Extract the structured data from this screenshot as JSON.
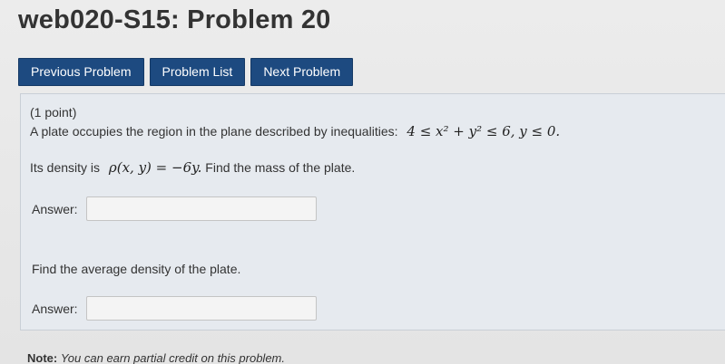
{
  "header": {
    "title": "web020-S15: Problem 20"
  },
  "nav": {
    "previous_label": "Previous Problem",
    "list_label": "Problem List",
    "next_label": "Next Problem"
  },
  "problem": {
    "points": "(1 point)",
    "statement": "A plate occupies the region in the plane described by inequalities:",
    "region_math": "4 ≤ x² + y² ≤ 6,  y ≤ 0.",
    "density_prefix": "Its density is",
    "density_math": "ρ(x, y) = −6y.",
    "density_suffix": "Find the mass of the plate.",
    "answer1_label": "Answer:",
    "answer1_value": "",
    "question2": "Find the average density of the plate.",
    "answer2_label": "Answer:",
    "answer2_value": ""
  },
  "note": {
    "label": "Note:",
    "text": "You can earn partial credit on this problem."
  }
}
